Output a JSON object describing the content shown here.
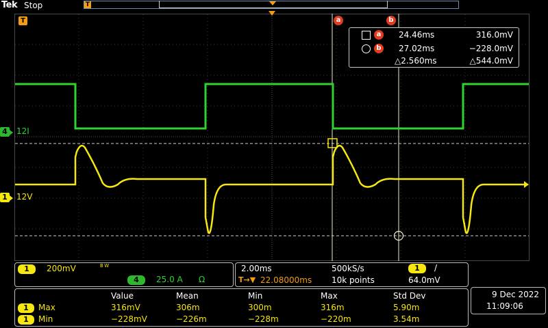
{
  "top": {
    "logo": "Tek",
    "state": "Stop",
    "trig_pos_glyph": "T"
  },
  "markers": {
    "trigger_glyph": "T",
    "cursor_a": "a",
    "cursor_b": "b"
  },
  "readout": {
    "a_time": "24.46ms",
    "a_value": "316.0mV",
    "b_time": "27.02ms",
    "b_value": "−228.0mV",
    "delta_time": "△2.560ms",
    "delta_value": "△544.0mV"
  },
  "channels": {
    "ch4": {
      "badge": "4",
      "label": "12I",
      "color": "#2fd32f"
    },
    "ch1": {
      "badge": "1",
      "label": "12V",
      "color": "#f5e70f"
    }
  },
  "vert_panel": {
    "ch1_badge": "1",
    "ch1_scale": "200mV",
    "bw_glyph": "B W",
    "ch4_badge": "4",
    "ch4_scale": "25.0 A",
    "ch4_ohm": "Ω"
  },
  "horiz_panel": {
    "timebase": "2.00ms",
    "sample_rate": "500kS/s",
    "trig_src_badge": "1",
    "trig_slope": "/",
    "trig_pos_icon": "T→▼",
    "trig_pos": "22.08000ms",
    "record_len": "10k points",
    "trig_level": "64.0mV"
  },
  "measurements": {
    "headers": [
      "Value",
      "Mean",
      "Min",
      "Max",
      "Std Dev"
    ],
    "rows": [
      {
        "badge": "1",
        "name": "Max",
        "cells": [
          "316mV",
          "306m",
          "300m",
          "316m",
          "5.90m"
        ]
      },
      {
        "badge": "1",
        "name": "Min",
        "cells": [
          "−228mV",
          "−226m",
          "−228m",
          "−220m",
          "3.54m"
        ]
      }
    ]
  },
  "datetime": {
    "date": "9 Dec  2022",
    "time": "11:09:06"
  },
  "colors": {
    "ch1": "#f5e70f",
    "ch4": "#2fd32f",
    "trigger": "#f39c12",
    "cursor": "#e23b1f"
  }
}
